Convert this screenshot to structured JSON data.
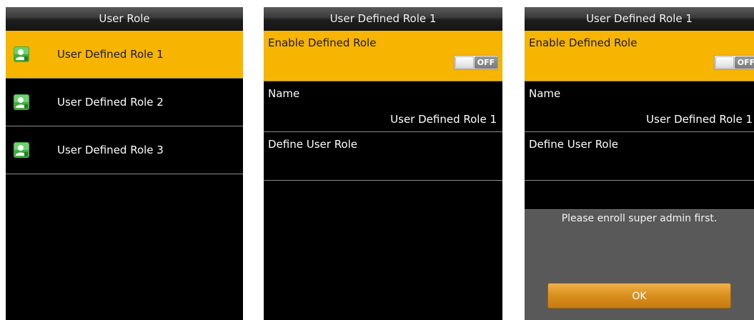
{
  "screen1": {
    "title": "User Role",
    "items": [
      {
        "label": "User Defined Role 1",
        "icon": "user-role-icon",
        "selected": true
      },
      {
        "label": "User Defined Role 2",
        "icon": "user-role-icon",
        "selected": false
      },
      {
        "label": "User Defined Role 3",
        "icon": "user-role-icon",
        "selected": false
      }
    ]
  },
  "screen2": {
    "title": "User Defined Role 1",
    "enable_label": "Enable Defined Role",
    "toggle_state": "OFF",
    "name_label": "Name",
    "name_value": "User Defined Role 1",
    "define_label": "Define User Role"
  },
  "screen3": {
    "title": "User Defined Role 1",
    "enable_label": "Enable Defined Role",
    "toggle_state": "OFF",
    "name_label": "Name",
    "name_value": "User Defined Role 1",
    "define_label": "Define User Role",
    "dialog": {
      "message": "Please enroll super admin first.",
      "ok_label": "OK"
    }
  },
  "colors": {
    "highlight": "#f7b400",
    "background": "#000000",
    "icon_green": "#3fae3f",
    "ok_button": "#d98f1c"
  }
}
